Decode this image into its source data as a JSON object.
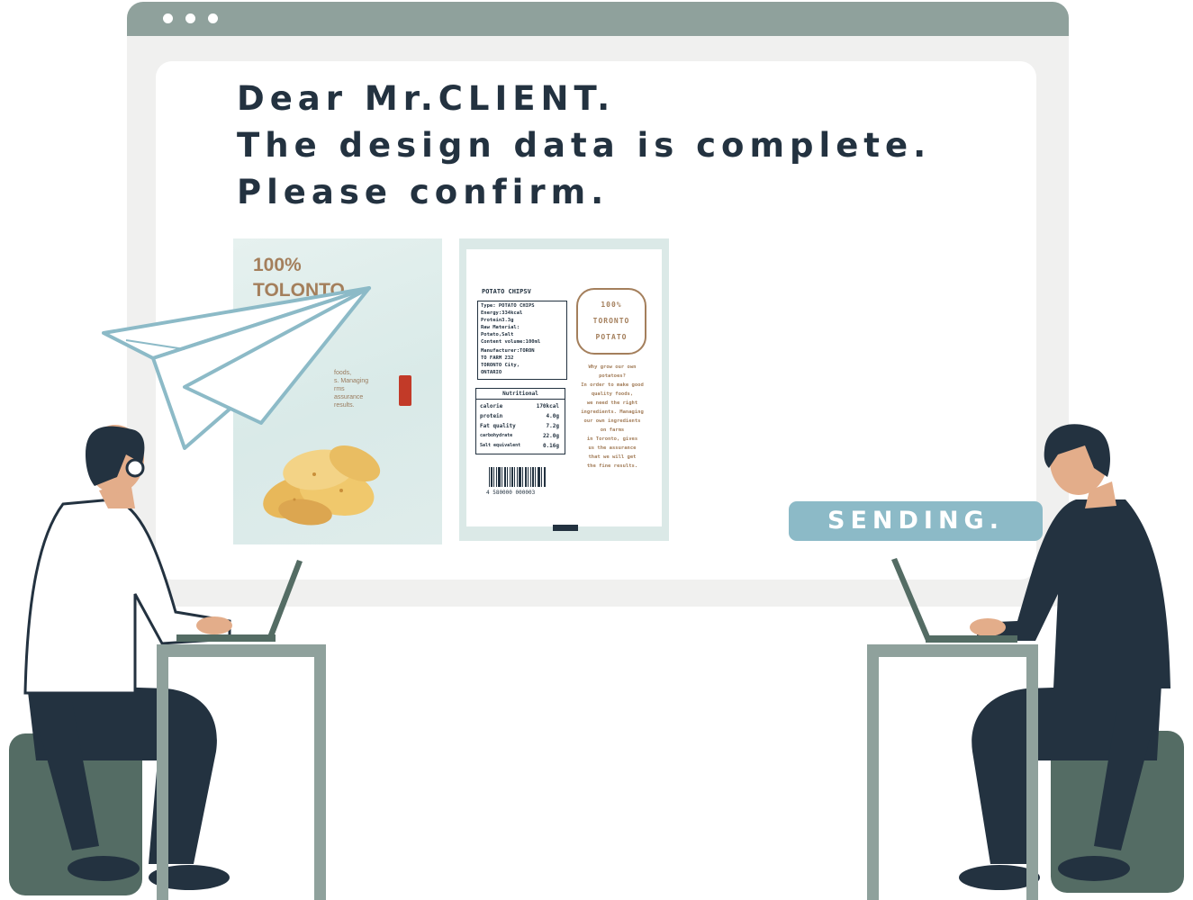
{
  "message": {
    "line1": "Dear Mr.CLIENT.",
    "line2": "The design data is complete.",
    "line3": "Please confirm."
  },
  "package_front": {
    "title_line1": "100%",
    "title_line2": "TOLONTO",
    "copy": [
      "foods,",
      "s. Managing",
      "rms",
      "assurance",
      "results."
    ]
  },
  "package_back": {
    "product_name": "POTATO CHIPSV",
    "spec_lines": [
      "Type: POTATO CHIPS",
      "Energy:334kcal",
      "Protein3.3g",
      "Raw Material:",
      "Potato,Salt",
      "Content volume:100ml",
      "Manufacturer:TORON",
      "TO FARM 232",
      "TORONTO City,",
      "ONTARIO"
    ],
    "nutrition_header": "Nutritional",
    "nutrition": [
      {
        "name": "calorie",
        "value": "170kcal"
      },
      {
        "name": "protein",
        "value": "4.0g"
      },
      {
        "name": "Fat quality",
        "value": "7.2g"
      },
      {
        "name": "carbohydrate",
        "value": "22.0g"
      },
      {
        "name": "Salt equivalent",
        "value": "0.16g"
      }
    ],
    "barcode_number": "4 580000 000003",
    "badge_line1": "100%",
    "badge_line2": "TORONTO",
    "badge_line3": "POTATO",
    "story": [
      "Why grow our own",
      "potatoes?",
      "In order to make good",
      "quality foods,",
      "we need the right",
      "ingredients. Managing",
      "our own ingredients",
      "on farms",
      "in Toronto, gives",
      "us the assurance",
      "that we will get",
      "the fine results."
    ]
  },
  "status": {
    "sending_label": "SENDING."
  },
  "colors": {
    "window_bar": "#8fa19c",
    "window_body": "#f0f0ef",
    "text_dark": "#233240",
    "accent_blue": "#8cbac7",
    "package_brown": "#a47f5c"
  }
}
